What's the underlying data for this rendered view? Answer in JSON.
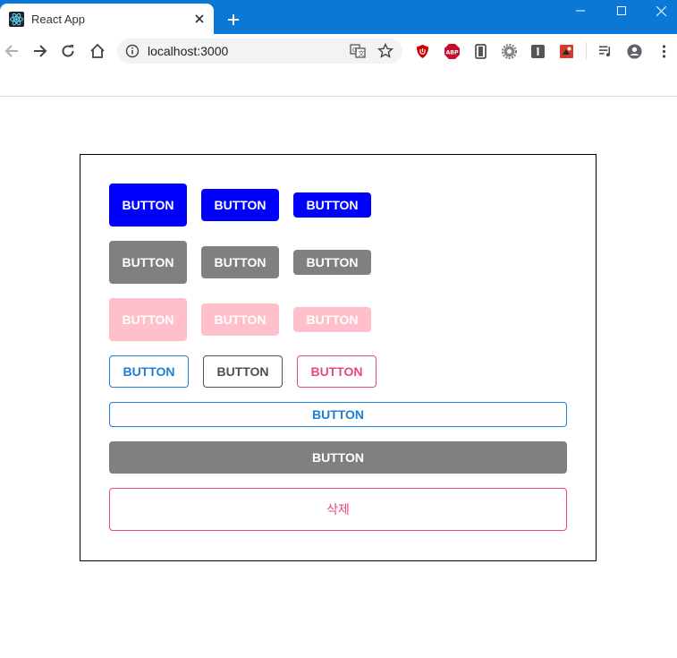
{
  "browser": {
    "tab_title": "React App",
    "url": "localhost:3000",
    "icons": {
      "favicon": "react-logo-icon",
      "tab_close": "close-icon",
      "new_tab": "plus-icon",
      "minimize": "minimize-icon",
      "maximize": "maximize-icon",
      "close_window": "close-icon",
      "back": "back-arrow-icon",
      "forward": "forward-arrow-icon",
      "reload": "reload-icon",
      "home": "home-icon",
      "site_info": "info-icon",
      "translate": "translate-icon",
      "bookmark": "star-icon",
      "extensions": [
        "ublock-icon",
        "adblock-plus-icon",
        "sidebar-extension-icon",
        "gear-extension-icon",
        "info-extension-icon",
        "puzzle-extension-icon"
      ],
      "media": "media-queue-icon",
      "profile": "account-circle-icon",
      "menu": "kebab-menu-icon"
    },
    "colors": {
      "titlebar": "#0b78d7"
    }
  },
  "page": {
    "rows": [
      {
        "color": "#0000ff",
        "buttons": [
          {
            "label": "BUTTON"
          },
          {
            "label": "BUTTON"
          },
          {
            "label": "BUTTON"
          }
        ]
      },
      {
        "color": "#808080",
        "buttons": [
          {
            "label": "BUTTON"
          },
          {
            "label": "BUTTON"
          },
          {
            "label": "BUTTON"
          }
        ]
      },
      {
        "color": "#ffc0cb",
        "buttons": [
          {
            "label": "BUTTON"
          },
          {
            "label": "BUTTON"
          },
          {
            "label": "BUTTON"
          }
        ]
      }
    ],
    "outline_row": [
      {
        "label": "BUTTON",
        "color": "#1c7ed6"
      },
      {
        "label": "BUTTON",
        "color": "#495057"
      },
      {
        "label": "BUTTON",
        "color": "#e64980"
      }
    ],
    "full_outline_button": {
      "label": "BUTTON",
      "color": "#1c7ed6"
    },
    "full_gray_button": {
      "label": "BUTTON",
      "color": "#808080"
    },
    "delete_button": {
      "label": "삭제",
      "color": "#e64980"
    }
  }
}
